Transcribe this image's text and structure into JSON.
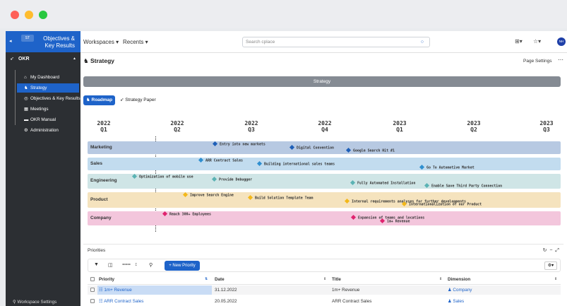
{
  "window": {
    "dots": [
      "#fe5f57",
      "#febc2e",
      "#28c840"
    ]
  },
  "sidebar": {
    "brand_badge": "ST",
    "brand_line1": "Objectives &",
    "brand_line2": "Key Results",
    "section": "OKR",
    "items": [
      {
        "label": "My Dashboard",
        "icon": "home-icon"
      },
      {
        "label": "Strategy",
        "icon": "strategy-icon",
        "active": true
      },
      {
        "label": "Objectives & Key Results",
        "icon": "target-icon"
      },
      {
        "label": "Meetings",
        "icon": "calendar-icon"
      },
      {
        "label": "OKR Manual",
        "icon": "book-icon"
      },
      {
        "label": "Administration",
        "icon": "gears-icon"
      }
    ],
    "workspace_settings": "Workspace Settings"
  },
  "topbar": {
    "workspaces": "Workspaces",
    "recents": "Recents",
    "search_placeholder": "Search cplace",
    "avatar": "NH"
  },
  "page": {
    "title": "Strategy",
    "page_settings": "Page Settings",
    "banner": "Strategy",
    "tab_roadmap": "Roadmap",
    "tab_paper": "Strategy Paper"
  },
  "quarters": [
    {
      "year": "2022",
      "q": "Q1"
    },
    {
      "year": "2022",
      "q": "Q2"
    },
    {
      "year": "2022",
      "q": "Q3"
    },
    {
      "year": "2022",
      "q": "Q4"
    },
    {
      "year": "2023",
      "q": "Q1"
    },
    {
      "year": "2023",
      "q": "Q2"
    },
    {
      "year": "2023",
      "q": "Q3"
    }
  ],
  "lanes": [
    {
      "label": "Marketing",
      "color": "#b7c9e2",
      "diamond": "#1e5fb8",
      "items": [
        "Entry into new markets",
        "Digital Convention",
        "Google Search Hit #1"
      ]
    },
    {
      "label": "Sales",
      "color": "#c2dcef",
      "diamond": "#2f8fd0",
      "items": [
        "ARR Contract Sales",
        "Building international sales teams",
        "Go To Automotive Market"
      ]
    },
    {
      "label": "Engineering",
      "color": "#cfe5e6",
      "diamond": "#5bb3b4",
      "items": [
        "Optimization of mobile use",
        "Provide Debugger",
        "Fully Automated Installation",
        "Enable Save Third Party Connection"
      ]
    },
    {
      "label": "Product",
      "color": "#f5e3be",
      "diamond": "#f3b81a",
      "items": [
        "Improve Search Engine",
        "Build Solution Template Team",
        "Internal requirements analyses for further developments",
        "Internationalization of our Product"
      ]
    },
    {
      "label": "Company",
      "color": "#f3c6dc",
      "diamond": "#e0236f",
      "items": [
        "Reach 300+ Employees",
        "Expansion of teams and locations",
        "1m+ Revenue"
      ]
    }
  ],
  "priorities": {
    "title": "Priorities",
    "new_button": "New Priority",
    "columns": [
      "Priority",
      "Date",
      "Title",
      "Dimension"
    ],
    "rows": [
      {
        "priority": "1m+ Revenue",
        "date": "31.12.2022",
        "title": "1m+ Revenue",
        "dimension": "Company"
      },
      {
        "priority": "ARR Contract Sales",
        "date": "20.05.2022",
        "title": "ARR Contract Sales",
        "dimension": "Sales"
      }
    ]
  }
}
